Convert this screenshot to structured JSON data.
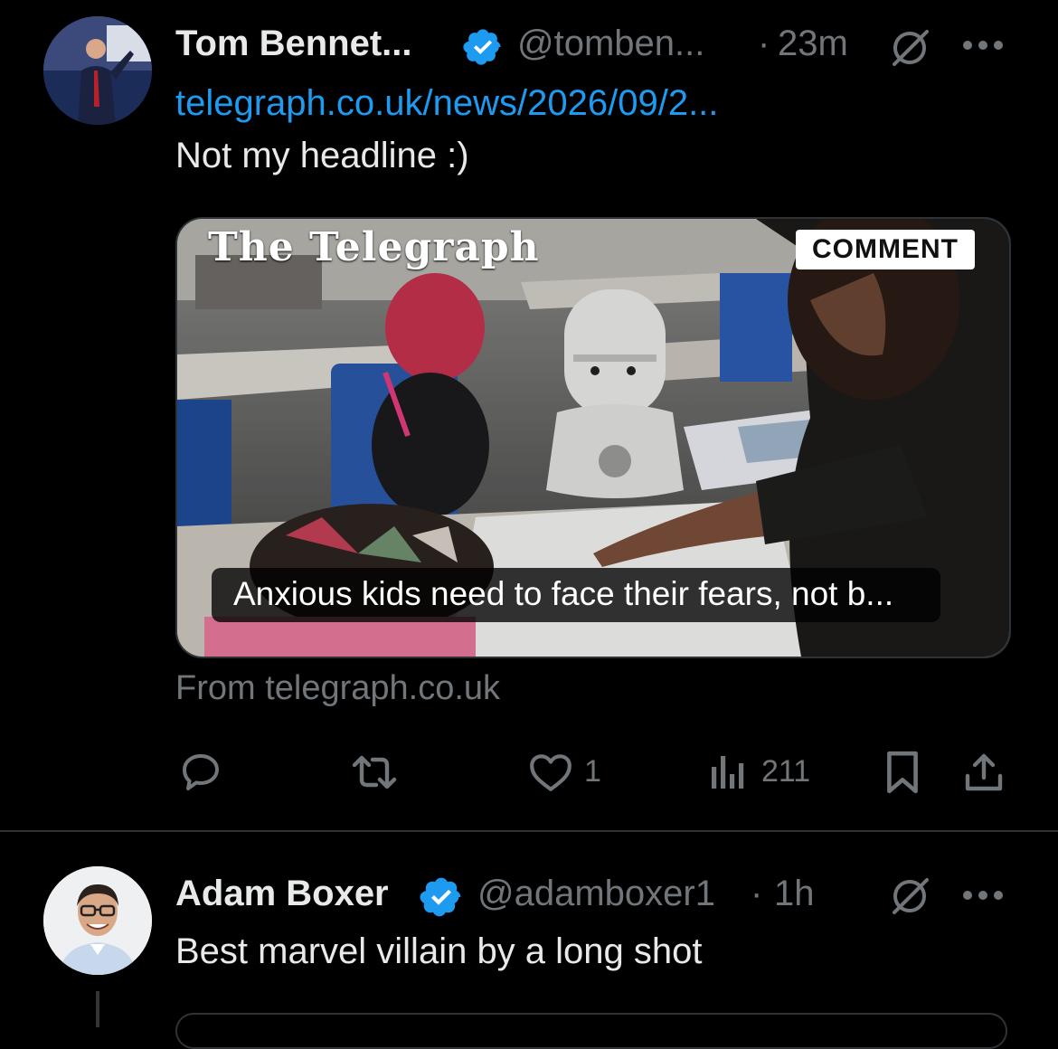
{
  "posts": [
    {
      "author_name": "Tom Bennet...",
      "handle": "@tomben...",
      "separator": "·",
      "time": "23m",
      "link_text": "telegraph.co.uk/news/2026/09/2...",
      "text": "Not my headline :)",
      "card": {
        "publisher": "The Telegraph",
        "badge": "COMMENT",
        "caption": "Anxious kids need to face their fears, not b...",
        "source": "From telegraph.co.uk"
      },
      "actions": {
        "replies": "",
        "reposts": "",
        "likes": "1",
        "views": "211"
      }
    },
    {
      "author_name": "Adam Boxer",
      "handle": "@adamboxer1",
      "separator": "·",
      "time": "1h",
      "text": "Best marvel villain by a long shot"
    }
  ],
  "colors": {
    "background": "#000000",
    "text": "#e7e9ea",
    "muted": "#71767b",
    "link": "#1d9bf0",
    "verified": "#1d9bf0",
    "border": "#2f3336"
  },
  "icons": [
    "verified-badge-icon",
    "grok-icon",
    "more-icon",
    "reply-icon",
    "repost-icon",
    "like-icon",
    "views-icon",
    "bookmark-icon",
    "share-icon"
  ]
}
